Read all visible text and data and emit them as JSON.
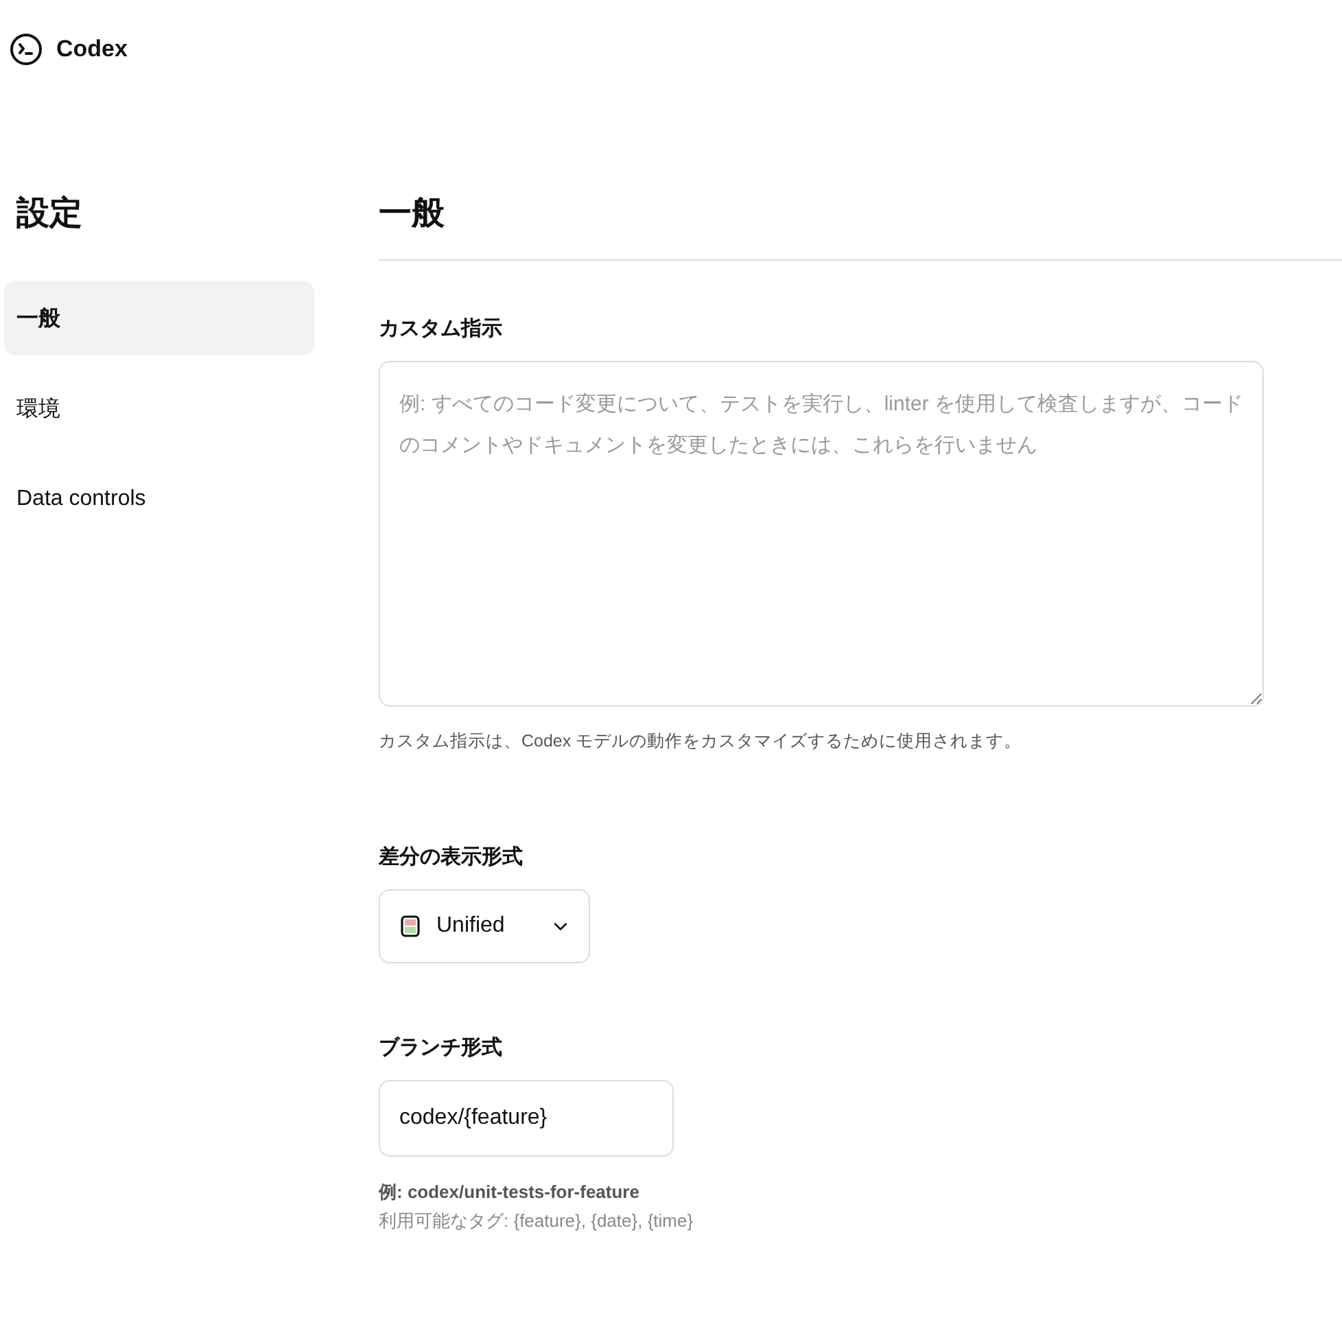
{
  "app": {
    "name": "Codex"
  },
  "sidebar": {
    "title": "設定",
    "items": [
      {
        "label": "一般",
        "selected": true
      },
      {
        "label": "環境",
        "selected": false
      },
      {
        "label": "Data controls",
        "selected": false
      }
    ]
  },
  "page": {
    "title": "一般"
  },
  "custom_instructions": {
    "label": "カスタム指示",
    "placeholder": "例: すべてのコード変更について、テストを実行し、linter を使用して検査しますが、コードのコメントやドキュメントを変更したときには、これらを行いません",
    "help": "カスタム指示は、Codex モデルの動作をカスタマイズするために使用されます。"
  },
  "diff_format": {
    "label": "差分の表示形式",
    "value": "Unified"
  },
  "branch_format": {
    "label": "ブランチ形式",
    "value": "codex/{feature}",
    "example": "例: codex/unit-tests-for-feature",
    "tags": "利用可能なタグ: {feature}, {date}, {time}"
  }
}
